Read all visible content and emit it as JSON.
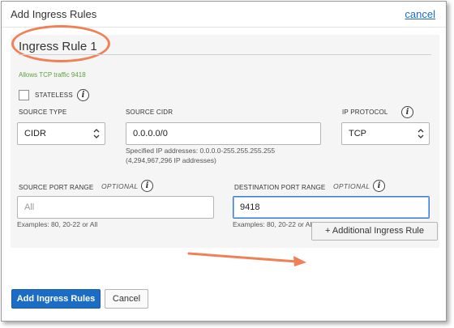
{
  "dialog": {
    "title": "Add Ingress Rules",
    "cancel_link": "cancel"
  },
  "rule": {
    "title": "Ingress Rule 1",
    "help_text": "Allows TCP traffic 9418",
    "stateless": {
      "label": "STATELESS",
      "checked": false
    },
    "source_type": {
      "label": "SOURCE TYPE",
      "value": "CIDR"
    },
    "source_cidr": {
      "label": "SOURCE CIDR",
      "value": "0.0.0.0/0",
      "note_line1": "Specified IP addresses: 0.0.0.0-255.255.255.255",
      "note_line2": "(4,294,967,296 IP addresses)"
    },
    "ip_protocol": {
      "label": "IP PROTOCOL",
      "value": "TCP"
    },
    "source_port_range": {
      "label": "SOURCE PORT RANGE",
      "optional": "OPTIONAL",
      "placeholder": "All",
      "value": "",
      "note": "Examples: 80, 20-22 or All"
    },
    "destination_port_range": {
      "label": "DESTINATION PORT RANGE",
      "optional": "OPTIONAL",
      "value": "9418",
      "note": "Examples: 80, 20-22 or All"
    }
  },
  "actions": {
    "additional_rule": "+ Additional Ingress Rule",
    "submit": "Add Ingress Rules",
    "cancel": "Cancel"
  },
  "icons": {
    "info": "i",
    "select_chevrons": "chevron-up-down-icon"
  },
  "colors": {
    "primary": "#1a6cc4",
    "help_green": "#5aa33b",
    "annotation": "#f08056",
    "panel_bg": "#f5f5f5"
  }
}
